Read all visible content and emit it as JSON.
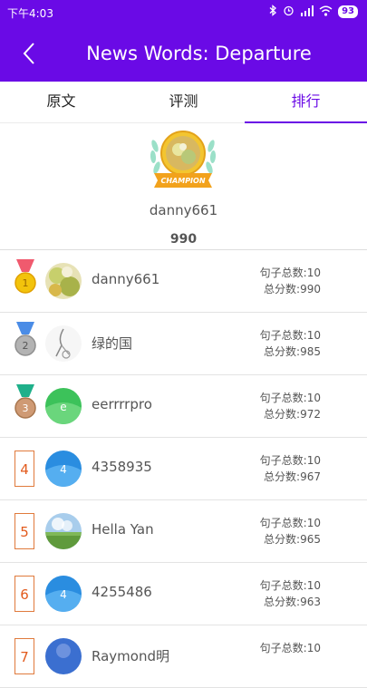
{
  "status": {
    "time": "下午4:03",
    "battery": "93"
  },
  "header": {
    "title": "News Words: Departure"
  },
  "tabs": [
    {
      "label": "原文",
      "active": false
    },
    {
      "label": "评测",
      "active": false
    },
    {
      "label": "排行",
      "active": true
    }
  ],
  "champion": {
    "badge_text": "CHAMPION",
    "name": "danny661",
    "score": "990"
  },
  "rows": [
    {
      "rank": "1",
      "name": "danny661",
      "sentences": "句子总数:10",
      "total": "总分数:990"
    },
    {
      "rank": "2",
      "name": "绿的国",
      "sentences": "句子总数:10",
      "total": "总分数:985"
    },
    {
      "rank": "3",
      "name": "eerrrrpro",
      "sentences": "句子总数:10",
      "total": "总分数:972",
      "avatar_letter": "e"
    },
    {
      "rank": "4",
      "name": "4358935",
      "sentences": "句子总数:10",
      "total": "总分数:967",
      "avatar_letter": "4"
    },
    {
      "rank": "5",
      "name": "Hella Yan",
      "sentences": "句子总数:10",
      "total": "总分数:965"
    },
    {
      "rank": "6",
      "name": "4255486",
      "sentences": "句子总数:10",
      "total": "总分数:963",
      "avatar_letter": "4"
    },
    {
      "rank": "7",
      "name": "Raymond明",
      "sentences": "句子总数:10",
      "total": ""
    }
  ],
  "colors": {
    "accent": "#6a0ae6",
    "rank_box": "#e25a1c",
    "gold": "#e8b400",
    "silver": "#a8a8a8",
    "bronze": "#c8906a"
  }
}
